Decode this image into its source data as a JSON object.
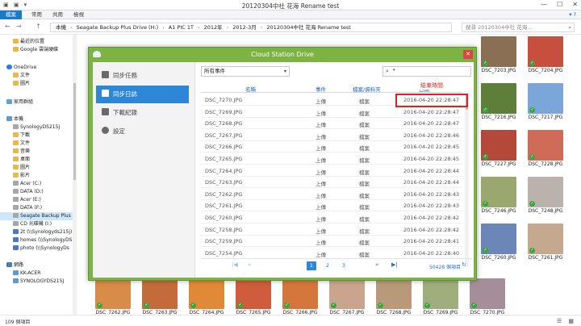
{
  "window": {
    "title": "20120304中社 花海 Rename test",
    "quick_access": "▣ ▣ ▾",
    "minimize": "—",
    "maximize": "☐",
    "close": "✕"
  },
  "ribbon": {
    "tabs": [
      "檔案",
      "常用",
      "共用",
      "檢視"
    ],
    "help": "▾ ?"
  },
  "address": {
    "back": "←",
    "forward": "→",
    "up": "↑",
    "crumbs": [
      "本機",
      "Seagate Backup Plus Drive (H:)",
      "A1 PIC 1T",
      "2012年",
      "2012-3月",
      "20120304中社 花海 Rename test"
    ],
    "separator": "›",
    "search_placeholder": "搜尋 20120304中社 花海...",
    "search_icon": "⌕"
  },
  "navpane": {
    "items": [
      {
        "label": "最近的位置",
        "icon": "folder",
        "indent": 1
      },
      {
        "label": "Google 雲端硬碟",
        "icon": "folder",
        "indent": 1
      },
      {
        "label": "OneDrive",
        "icon": "cloud",
        "indent": 0
      },
      {
        "label": "文件",
        "icon": "folder",
        "indent": 1
      },
      {
        "label": "圖片",
        "icon": "folder",
        "indent": 1
      },
      {
        "label": "家用群組",
        "icon": "home",
        "indent": 0
      },
      {
        "label": "本機",
        "icon": "pc",
        "indent": 0
      },
      {
        "label": "SynologyDS215J",
        "icon": "drive",
        "indent": 1
      },
      {
        "label": "下載",
        "icon": "folder",
        "indent": 1
      },
      {
        "label": "文件",
        "icon": "folder",
        "indent": 1
      },
      {
        "label": "音樂",
        "icon": "folder",
        "indent": 1
      },
      {
        "label": "桌面",
        "icon": "folder",
        "indent": 1
      },
      {
        "label": "圖片",
        "icon": "folder",
        "indent": 1
      },
      {
        "label": "影片",
        "icon": "folder",
        "indent": 1
      },
      {
        "label": "Acer (C:)",
        "icon": "drive",
        "indent": 1
      },
      {
        "label": "DATA (D:)",
        "icon": "drive",
        "indent": 1
      },
      {
        "label": "Acer (E:)",
        "icon": "drive",
        "indent": 1
      },
      {
        "label": "DATA (F:)",
        "icon": "drive",
        "indent": 1
      },
      {
        "label": "Seagate Backup Plus D",
        "icon": "drive",
        "indent": 1,
        "selected": true
      },
      {
        "label": "CD 光碟機 (I:)",
        "icon": "drive",
        "indent": 1
      },
      {
        "label": "2t (\\\\Synologyds215j)",
        "icon": "net",
        "indent": 1
      },
      {
        "label": "homes (\\\\SynologyDS",
        "icon": "net",
        "indent": 1
      },
      {
        "label": "photo (\\\\SynologyDs",
        "icon": "net",
        "indent": 1
      },
      {
        "label": "網路",
        "icon": "net",
        "indent": 0
      },
      {
        "label": "KK-ACER",
        "icon": "pc",
        "indent": 1
      },
      {
        "label": "SYNOLOGYDS215J",
        "icon": "pc",
        "indent": 1
      }
    ]
  },
  "thumbnails": {
    "right": [
      {
        "name": "DSC_7203.JPG",
        "color": "#8a6f55"
      },
      {
        "name": "DSC_7204.JPG",
        "color": "#c74f3e"
      },
      {
        "name": "DSC_7216.JPG",
        "color": "#5d7f3a"
      },
      {
        "name": "DSC_7217.JPG",
        "color": "#7aa7d8"
      },
      {
        "name": "DSC_7227.JPG",
        "color": "#b4493a"
      },
      {
        "name": "DSC_7228.JPG",
        "color": "#cf6b57"
      },
      {
        "name": "DSC_7246.JPG",
        "color": "#9aa86f"
      },
      {
        "name": "DSC_7248.JPG",
        "color": "#b9b2ad"
      },
      {
        "name": "DSC_7260.JPG",
        "color": "#6c86b8"
      },
      {
        "name": "DSC_7261.JPG",
        "color": "#c5a98f"
      }
    ],
    "bottom": [
      {
        "name": "DSC_7262.JPG",
        "color": "#d98b4a"
      },
      {
        "name": "DSC_7263.JPG",
        "color": "#c46b3b"
      },
      {
        "name": "DSC_7264.JPG",
        "color": "#e08a37"
      },
      {
        "name": "DSC_7265.JPG",
        "color": "#cf5c3c"
      },
      {
        "name": "DSC_7266.JPG",
        "color": "#d5773d"
      },
      {
        "name": "DSC_7267.JPG",
        "color": "#caa48e"
      },
      {
        "name": "DSC_7268.JPG",
        "color": "#b89a7a"
      },
      {
        "name": "DSC_7269.JPG",
        "color": "#9fae7c"
      },
      {
        "name": "DSC_7270.JPG",
        "color": "#a58e9a"
      }
    ],
    "check": "✓"
  },
  "status": {
    "item_count": "109 個項目",
    "view_icons": "☰ ▦"
  },
  "dialog": {
    "title": "Cloud Station Drive",
    "close": "✕",
    "sidebar": [
      {
        "label": "同步任務",
        "icon": "doc-icon",
        "active": false
      },
      {
        "label": "同步日誌",
        "icon": "log-icon",
        "active": true
      },
      {
        "label": "下載紀錄",
        "icon": "download-icon",
        "active": false
      },
      {
        "label": "設定",
        "icon": "gear-icon",
        "active": false
      }
    ],
    "filter": {
      "value": "所有事件",
      "caret": "▾"
    },
    "search": {
      "icon": "⌕",
      "caret": "▾"
    },
    "columns": [
      "名稱",
      "事件",
      "檔案/資料夾",
      "日期"
    ],
    "rows": [
      {
        "name": "DSC_7270.JPG",
        "event": "上傳",
        "type": "檔案",
        "time": "2016-04-20 22:28:47"
      },
      {
        "name": "DSC_7269.JPG",
        "event": "上傳",
        "type": "檔案",
        "time": "2016-04-20 22:28:47"
      },
      {
        "name": "DSC_7268.JPG",
        "event": "上傳",
        "type": "檔案",
        "time": "2016-04-20 22:28:47"
      },
      {
        "name": "DSC_7267.JPG",
        "event": "上傳",
        "type": "檔案",
        "time": "2016-04-20 22:28:46"
      },
      {
        "name": "DSC_7266.JPG",
        "event": "上傳",
        "type": "檔案",
        "time": "2016-04-20 22:28:45"
      },
      {
        "name": "DSC_7265.JPG",
        "event": "上傳",
        "type": "檔案",
        "time": "2016-04-20 22:28:45"
      },
      {
        "name": "DSC_7264.JPG",
        "event": "上傳",
        "type": "檔案",
        "time": "2016-04-20 22:28:44"
      },
      {
        "name": "DSC_7263.JPG",
        "event": "上傳",
        "type": "檔案",
        "time": "2016-04-20 22:28:44"
      },
      {
        "name": "DSC_7262.JPG",
        "event": "上傳",
        "type": "檔案",
        "time": "2016-04-20 22:28:43"
      },
      {
        "name": "DSC_7261.JPG",
        "event": "上傳",
        "type": "檔案",
        "time": "2016-04-20 22:28:43"
      },
      {
        "name": "DSC_7260.JPG",
        "event": "上傳",
        "type": "檔案",
        "time": "2016-04-20 22:28:42"
      },
      {
        "name": "DSC_7258.JPG",
        "event": "上傳",
        "type": "檔案",
        "time": "2016-04-20 22:28:42"
      },
      {
        "name": "DSC_7259.JPG",
        "event": "上傳",
        "type": "檔案",
        "time": "2016-04-20 22:28:41"
      },
      {
        "name": "DSC_7254.JPG",
        "event": "上傳",
        "type": "檔案",
        "time": "2016-04-20 22:28:40"
      }
    ],
    "annotation": "結束時間",
    "pager": {
      "first": "|◀",
      "prev2": "«",
      "pages": [
        "1",
        "2",
        "3"
      ],
      "current": "1",
      "next2": "»",
      "last": "▶|",
      "count": "50428 個項目",
      "refresh": "↻"
    }
  }
}
